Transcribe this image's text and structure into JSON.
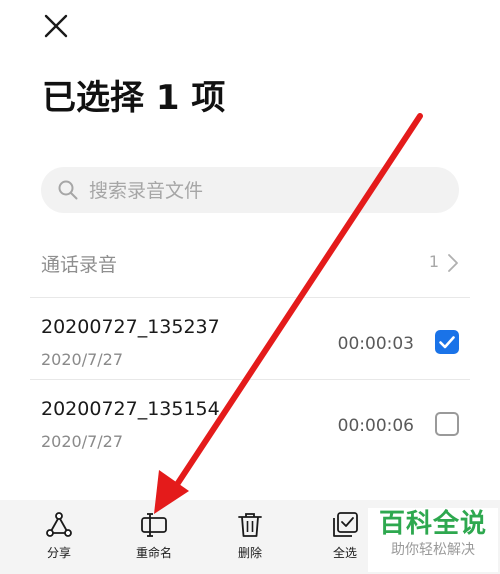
{
  "header": {
    "title": "已选择 1 项",
    "close_icon": "close-icon"
  },
  "search": {
    "placeholder": "搜索录音文件",
    "icon": "search-icon"
  },
  "section": {
    "label": "通话录音",
    "count": "1",
    "chevron_icon": "chevron-right-icon"
  },
  "recordings": [
    {
      "name": "20200727_135237",
      "date": "2020/7/27",
      "duration": "00:00:03",
      "selected": true
    },
    {
      "name": "20200727_135154",
      "date": "2020/7/27",
      "duration": "00:00:06",
      "selected": false
    }
  ],
  "toolbar": {
    "share_label": "分享",
    "rename_label": "重命名",
    "delete_label": "删除",
    "select_all_label": "全选"
  },
  "watermark": {
    "main": "百科全说",
    "sub": "助你轻松解决"
  },
  "colors": {
    "accent": "#1a73e8",
    "annotation_arrow": "#e41b1b",
    "watermark_green": "#2ea84f"
  }
}
